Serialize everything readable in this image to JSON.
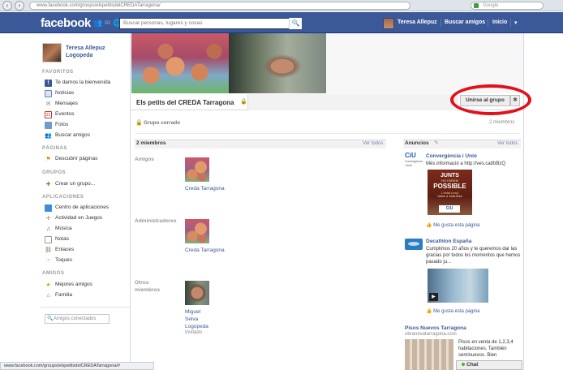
{
  "browser": {
    "url": "www.facebook.com/groups/elspetitsdelCREDATarragona/",
    "search_placeholder": "Google"
  },
  "topbar": {
    "logo": "facebook",
    "search_placeholder": "Buscar personas, lugares y cosas",
    "user_name": "Teresa Allepuz",
    "find_friends": "Buscar amigos",
    "home": "Inicio"
  },
  "sidebar": {
    "profile_name": "Teresa Allepuz Logopeda",
    "sections": {
      "favorites": "FAVORITOS",
      "pages": "PÁGINAS",
      "groups": "GRUPOS",
      "apps": "APLICACIONES",
      "friends": "AMIGOS"
    },
    "favorites": [
      {
        "label": "Te damos la bienvenida",
        "icon": "facebook-icon"
      },
      {
        "label": "Noticias",
        "icon": "news-feed-icon"
      },
      {
        "label": "Mensajes",
        "icon": "messages-icon"
      },
      {
        "label": "Eventos",
        "icon": "calendar-icon"
      },
      {
        "label": "Fotos",
        "icon": "photos-icon"
      },
      {
        "label": "Buscar amigos",
        "icon": "find-friends-icon"
      }
    ],
    "pages": [
      {
        "label": "Descubrir páginas",
        "icon": "discover-pages-icon"
      }
    ],
    "groups": [
      {
        "label": "Crear un grupo...",
        "icon": "create-group-icon"
      }
    ],
    "apps": [
      {
        "label": "Centro de aplicaciones",
        "icon": "app-center-icon"
      },
      {
        "label": "Actividad en Juegos",
        "icon": "games-icon"
      },
      {
        "label": "Música",
        "icon": "music-icon"
      },
      {
        "label": "Notas",
        "icon": "notes-icon"
      },
      {
        "label": "Enlaces",
        "icon": "links-icon"
      },
      {
        "label": "Toques",
        "icon": "pokes-icon"
      }
    ],
    "friends": [
      {
        "label": "Mejores amigos",
        "icon": "best-friends-icon"
      },
      {
        "label": "Familia",
        "icon": "family-icon"
      }
    ],
    "chat_search_placeholder": "Amigos conectados"
  },
  "group": {
    "title": "Els petits del CREDA Tarragona",
    "join_button": "Unirse al grupo",
    "privacy": "Grupo cerrado",
    "member_count": "2 miembros"
  },
  "members": {
    "title": "2 miembros",
    "see_all": "Ver todos",
    "roles": [
      {
        "label": "Amigos",
        "name": "Creda Tarragona",
        "sub": ""
      },
      {
        "label": "Administradores",
        "name": "Creda Tarragona",
        "sub": ""
      },
      {
        "label": "Otros miembros",
        "name": "Miguel Selva Logopeda",
        "sub": "Invitado"
      }
    ]
  },
  "ads": {
    "title": "Anuncios",
    "see_all": "Ver todos",
    "items": [
      {
        "title": "Convergència i Unió",
        "body": "Més informació a http://ves.cat/bBzQ",
        "like": "Me gusta esta página",
        "logo": "CiU",
        "logo_sub": "Convergència i Unió",
        "image_text": [
          "JUNTS",
          "HO FAREM",
          "POSSIBLE",
          "L'estat propi",
          "CiU",
          "Votem a Junts Artur"
        ]
      },
      {
        "title": "Decathlon España",
        "body": "Cumplimos 20 años y te queremos dar las gracias por todos los momentos que hemos pasado ju...",
        "like": "Me gusta esta página"
      },
      {
        "title": "Pisos Nuevos Tarragona",
        "url": "obranovatarragona.com",
        "body": "Pisos en venta de 1,2,3,4 habitaciones. También seminuevos. Bien"
      }
    ]
  },
  "chat": {
    "label": "Chat"
  },
  "status_bar": "www.facebook.com/groups/elspetitsdelCREDATarragona/#",
  "colors": {
    "brand": "#3b5998",
    "highlight_oval": "#e2101a"
  }
}
